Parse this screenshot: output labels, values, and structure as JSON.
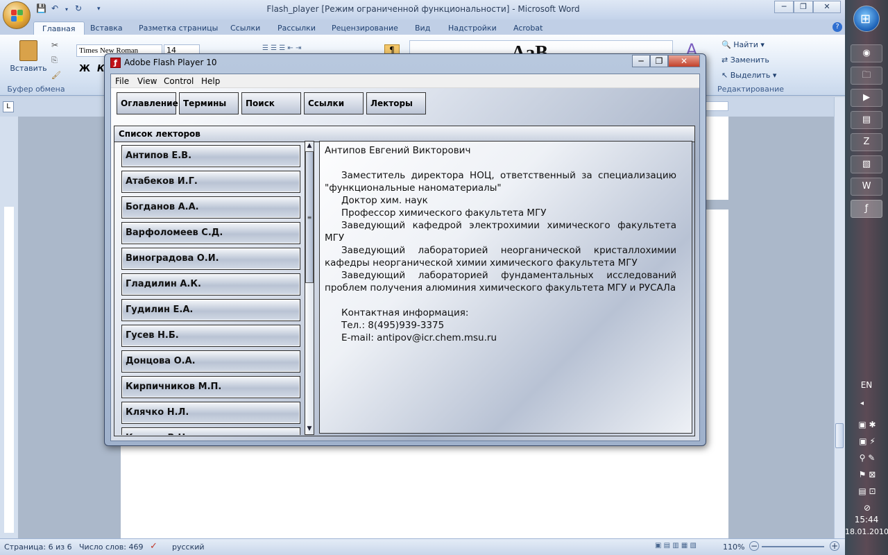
{
  "word": {
    "title": "Flash_player [Режим ограниченной функциональности] - Microsoft Word",
    "tabs": [
      "Главная",
      "Вставка",
      "Разметка страницы",
      "Ссылки",
      "Рассылки",
      "Рецензирование",
      "Вид",
      "Надстройки",
      "Acrobat"
    ],
    "font_name": "Times New Roman",
    "font_size": "14",
    "paste_label": "Вставить",
    "clipboard_group": "Буфер обмена",
    "bold_label": "Ж",
    "italic_label": "К",
    "find_label": "Найти",
    "replace_label": "Заменить",
    "select_label": "Выделить",
    "editing_group": "Редактирование",
    "status": {
      "page": "Страница: 6 из 6",
      "words": "Число слов: 469",
      "language": "русский",
      "zoom": "110%"
    }
  },
  "flash": {
    "title": "Adobe Flash Player 10",
    "menus": [
      "File",
      "View",
      "Control",
      "Help"
    ],
    "nav_tabs": [
      "Оглавление",
      "Термины",
      "Поиск",
      "Ссылки",
      "Лекторы"
    ],
    "list_header": "Список лекторов",
    "lecturers": [
      "Антипов Е.В.",
      "Атабеков И.Г.",
      "Богданов А.А.",
      "Варфоломеев С.Д.",
      "Виноградова О.И.",
      "Гладилин А.К.",
      "Гудилин Е.А.",
      "Гусев Н.Б.",
      "Донцова О.А.",
      "Кирпичников М.П.",
      "Клячко Н.Л.",
      "Кнорре В.Н."
    ],
    "detail": {
      "name": "Антипов Евгений Викторович",
      "paragraphs": [
        "Заместитель директора НОЦ, ответственный за специализацию \"функциональные наноматериалы\"",
        "Доктор хим. наук",
        "Профессор химического факультета МГУ",
        "Заведующий кафедрой электрохимии химического факультета МГУ",
        "Заведующий лабораторией неорганической кристаллохимии кафедры неорганической химии химического факультета МГУ",
        "Заведующий лабораторией фундаментальных исследований проблем получения алюминия химического факультета МГУ и РУСАЛа"
      ],
      "contact_title": "Контактная информация:",
      "phone": "Тел.: 8(495)939-3375",
      "email": "E-mail: antipov@icr.chem.msu.ru"
    }
  },
  "taskbar": {
    "lang": "EN",
    "time": "15:44",
    "date": "18.01.2010"
  }
}
